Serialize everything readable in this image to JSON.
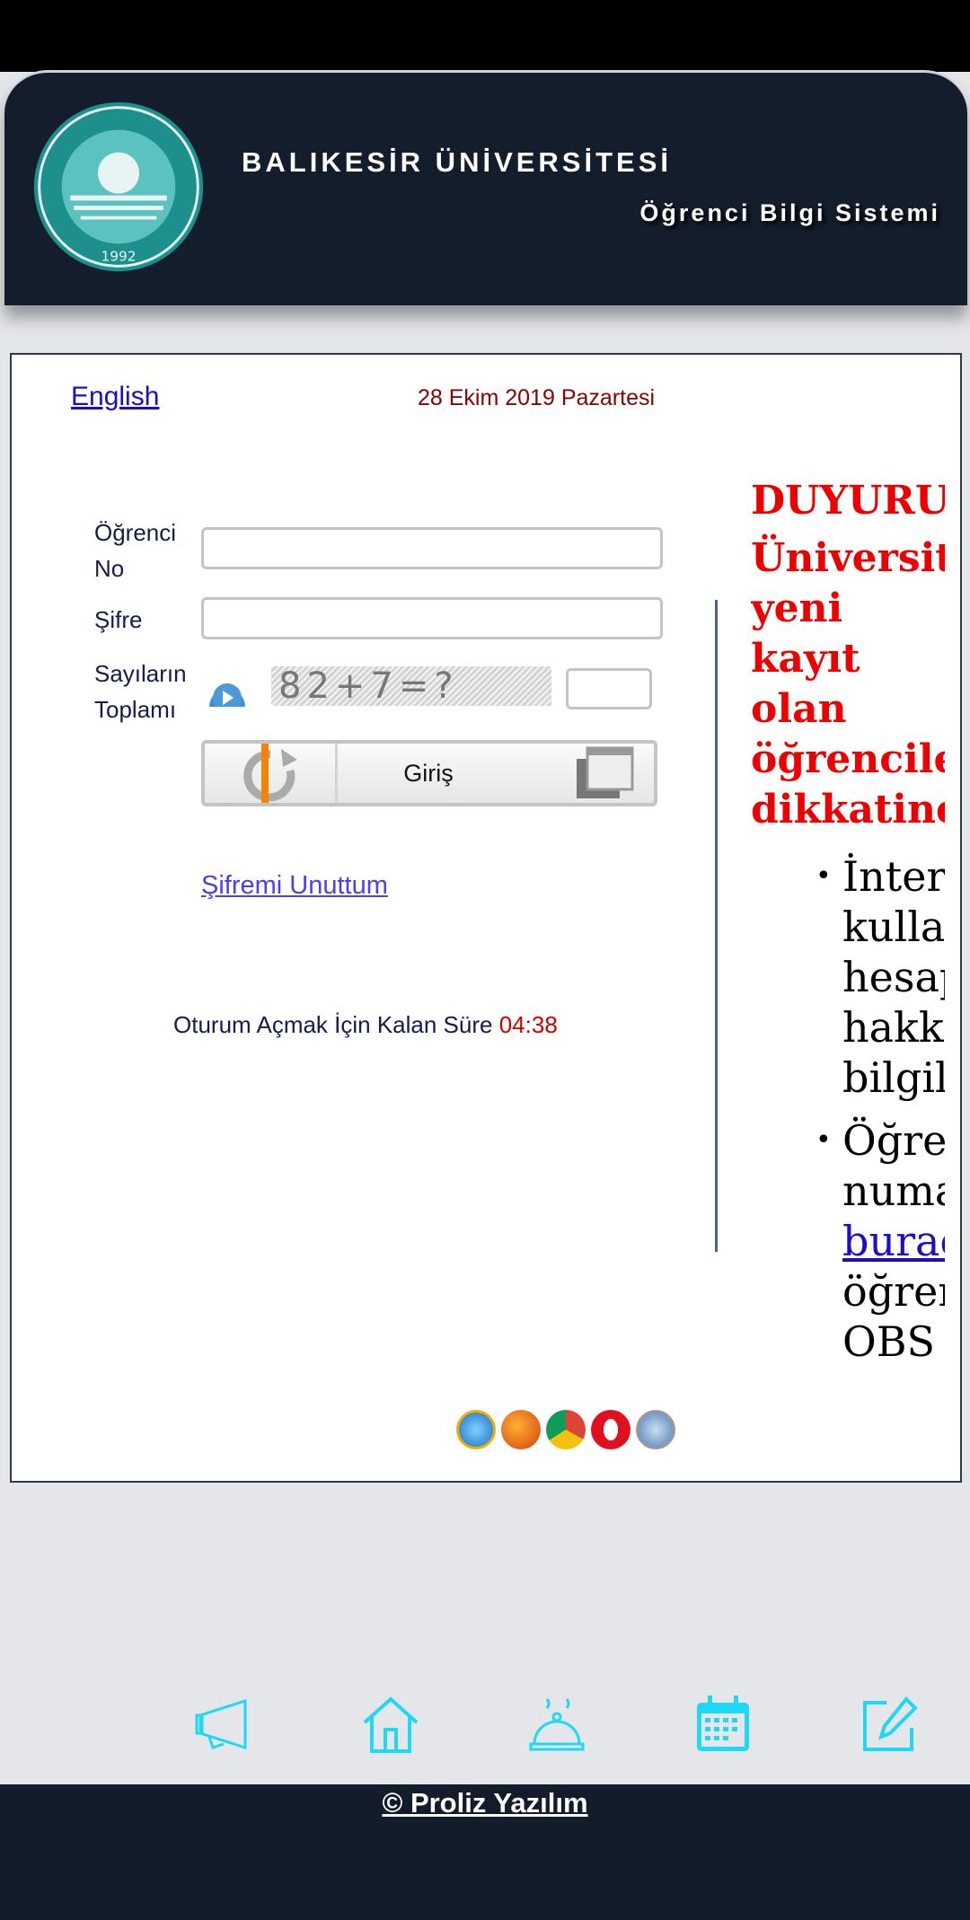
{
  "header": {
    "title": "BALIKESİR ÜNİVERSİTESİ",
    "subtitle": "Öğrenci Bilgi Sistemi",
    "logo_text": "BALIKESİR ÜNİVERSİTESİ 1992"
  },
  "top": {
    "language_link": "English",
    "date": "28 Ekim 2019 Pazartesi"
  },
  "form": {
    "student_no_label_1": "Öğrenci",
    "student_no_label_2": "No",
    "student_no_value": "",
    "password_label": "Şifre",
    "password_value": "",
    "captcha_label_1": "Sayıların",
    "captcha_label_2": "Toplamı",
    "captcha_text": "82+7=?",
    "captcha_value": "",
    "login_label": "Giriş",
    "forgot_link": "Şifremi Unuttum",
    "timer_label": "Oturum Açmak İçin Kalan Süre",
    "timer_value": "04:38"
  },
  "announcement": {
    "heading": "DUYURU:",
    "subheading": [
      "Üniversitemize",
      "yeni",
      "kayıt",
      "olan",
      "öğrencilerimizin",
      "dikkatine"
    ],
    "items": [
      [
        "İnternet",
        "kullanıcı",
        "hesapları",
        "hakkında",
        "bilgiler"
      ],
      [
        "Öğrenci",
        "numaranızı"
      ]
    ],
    "link": "buradan",
    "after_link": "öğrenebilirsiniz",
    "cut": "OBS"
  },
  "browsers": [
    "internet-explorer",
    "firefox",
    "chrome",
    "opera",
    "safari"
  ],
  "nav": [
    "megaphone-icon",
    "home-icon",
    "food-service-icon",
    "calendar-icon",
    "edit-icon"
  ],
  "footer": {
    "copyright": "© Proliz Yazılım"
  },
  "colors": {
    "header": "#141d2b",
    "accent": "#1ed8f5",
    "alert": "#ee0000"
  }
}
